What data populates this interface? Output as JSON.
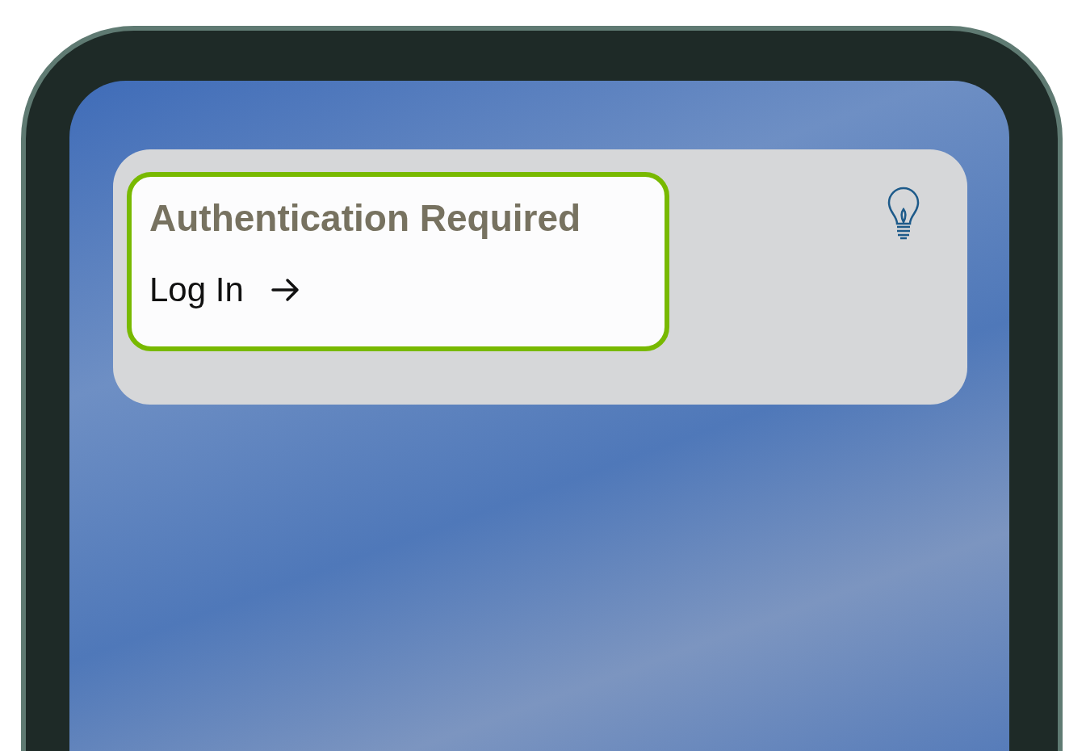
{
  "notice": {
    "title": "Authentication Required",
    "action": {
      "label": "Log In"
    }
  }
}
